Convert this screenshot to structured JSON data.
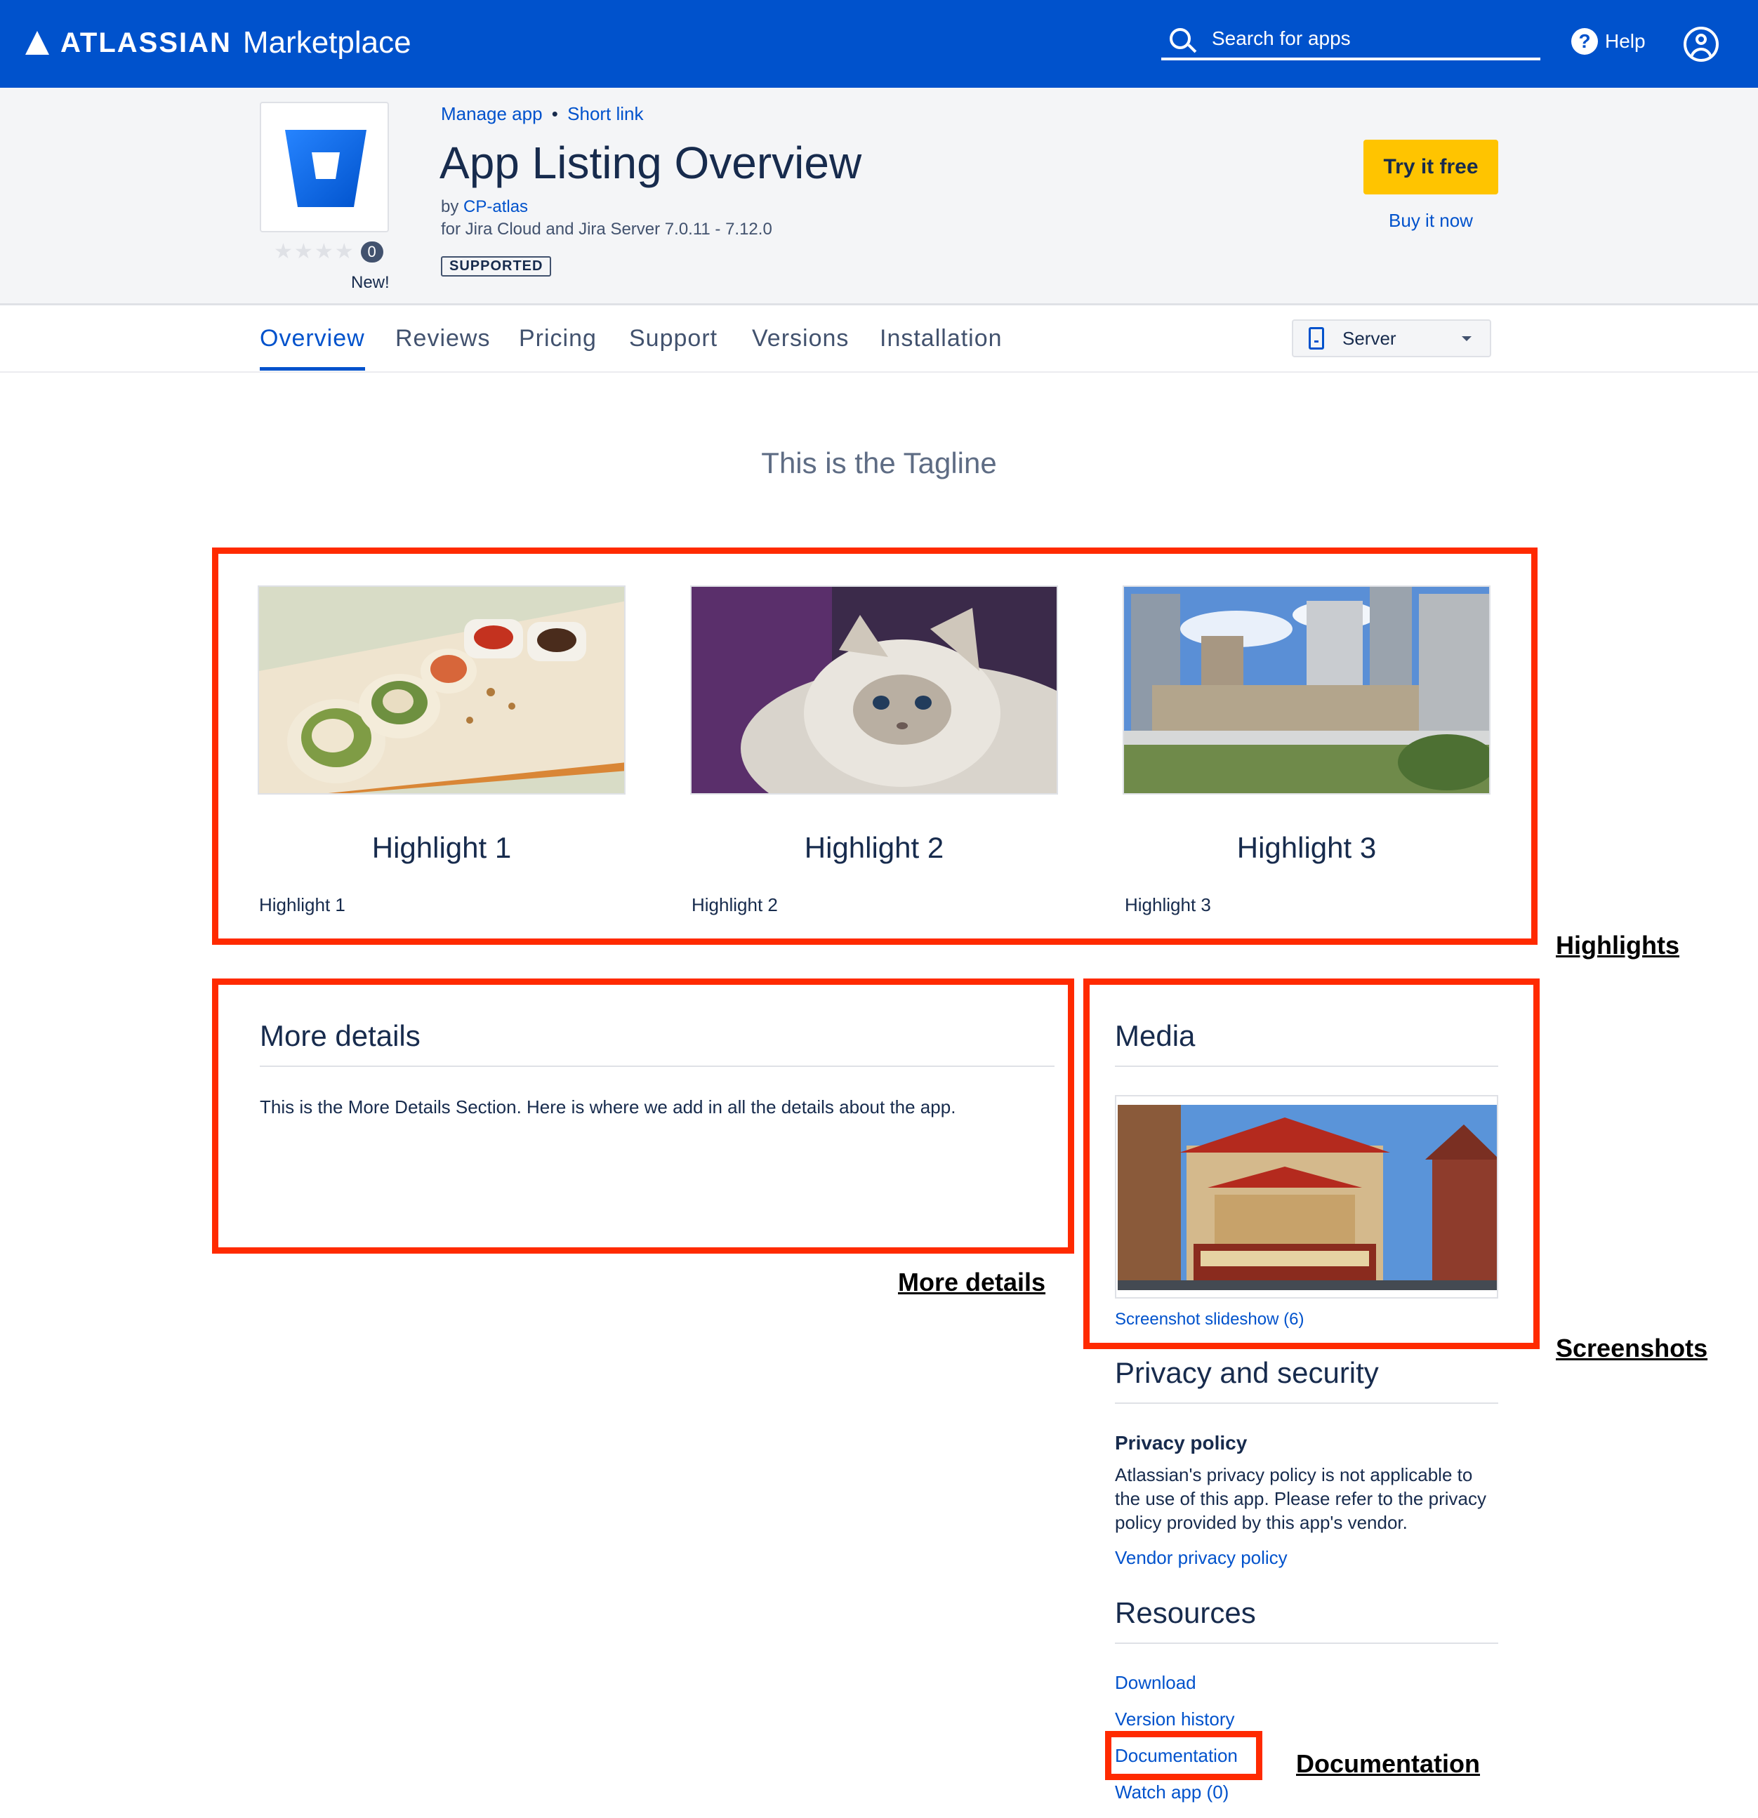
{
  "header": {
    "brand": "ATLASSIAN",
    "product": "Marketplace",
    "search_placeholder": "Search for apps",
    "help_label": "Help"
  },
  "listing": {
    "manage_app": "Manage app",
    "separator": "•",
    "short_link": "Short link",
    "title": "App Listing Overview",
    "by": "by",
    "vendor": "CP-atlas",
    "compatibility": "for Jira Cloud and Jira Server 7.0.11 - 7.12.0",
    "badge": "SUPPORTED",
    "rating_count": "0",
    "rating_stars": 0,
    "new_label": "New!",
    "try_button": "Try it free",
    "buy_link": "Buy it now"
  },
  "tabs": [
    {
      "label": "Overview"
    },
    {
      "label": "Reviews"
    },
    {
      "label": "Pricing"
    },
    {
      "label": "Support"
    },
    {
      "label": "Versions"
    },
    {
      "label": "Installation"
    }
  ],
  "hosting": {
    "selected": "Server"
  },
  "tagline": "This is the Tagline",
  "highlights": [
    {
      "title": "Highlight 1",
      "text": "Highlight 1"
    },
    {
      "title": "Highlight 2",
      "text": "Highlight 2"
    },
    {
      "title": "Highlight 3",
      "text": "Highlight 3"
    }
  ],
  "more_details": {
    "title": "More details",
    "text": "This is the More Details Section. Here is where we add in all the details about the app."
  },
  "media": {
    "title": "Media",
    "slideshow_link": "Screenshot slideshow (6)"
  },
  "privacy": {
    "title": "Privacy and security",
    "subheading": "Privacy policy",
    "text": "Atlassian's privacy policy is not applicable to the use of this app. Please refer to the privacy policy provided by this app's vendor.",
    "vendor_link": "Vendor privacy policy"
  },
  "resources": {
    "title": "Resources",
    "links": [
      "Download",
      "Version history",
      "Documentation",
      "Watch app (0)"
    ]
  },
  "annotations": {
    "highlights": "Highlights",
    "more_details": "More details",
    "screenshots": "Screenshots",
    "documentation": "Documentation"
  },
  "colors": {
    "brand_blue": "#0052cc",
    "cta_yellow": "#ffc400",
    "annotation_red": "#ff2a00"
  }
}
